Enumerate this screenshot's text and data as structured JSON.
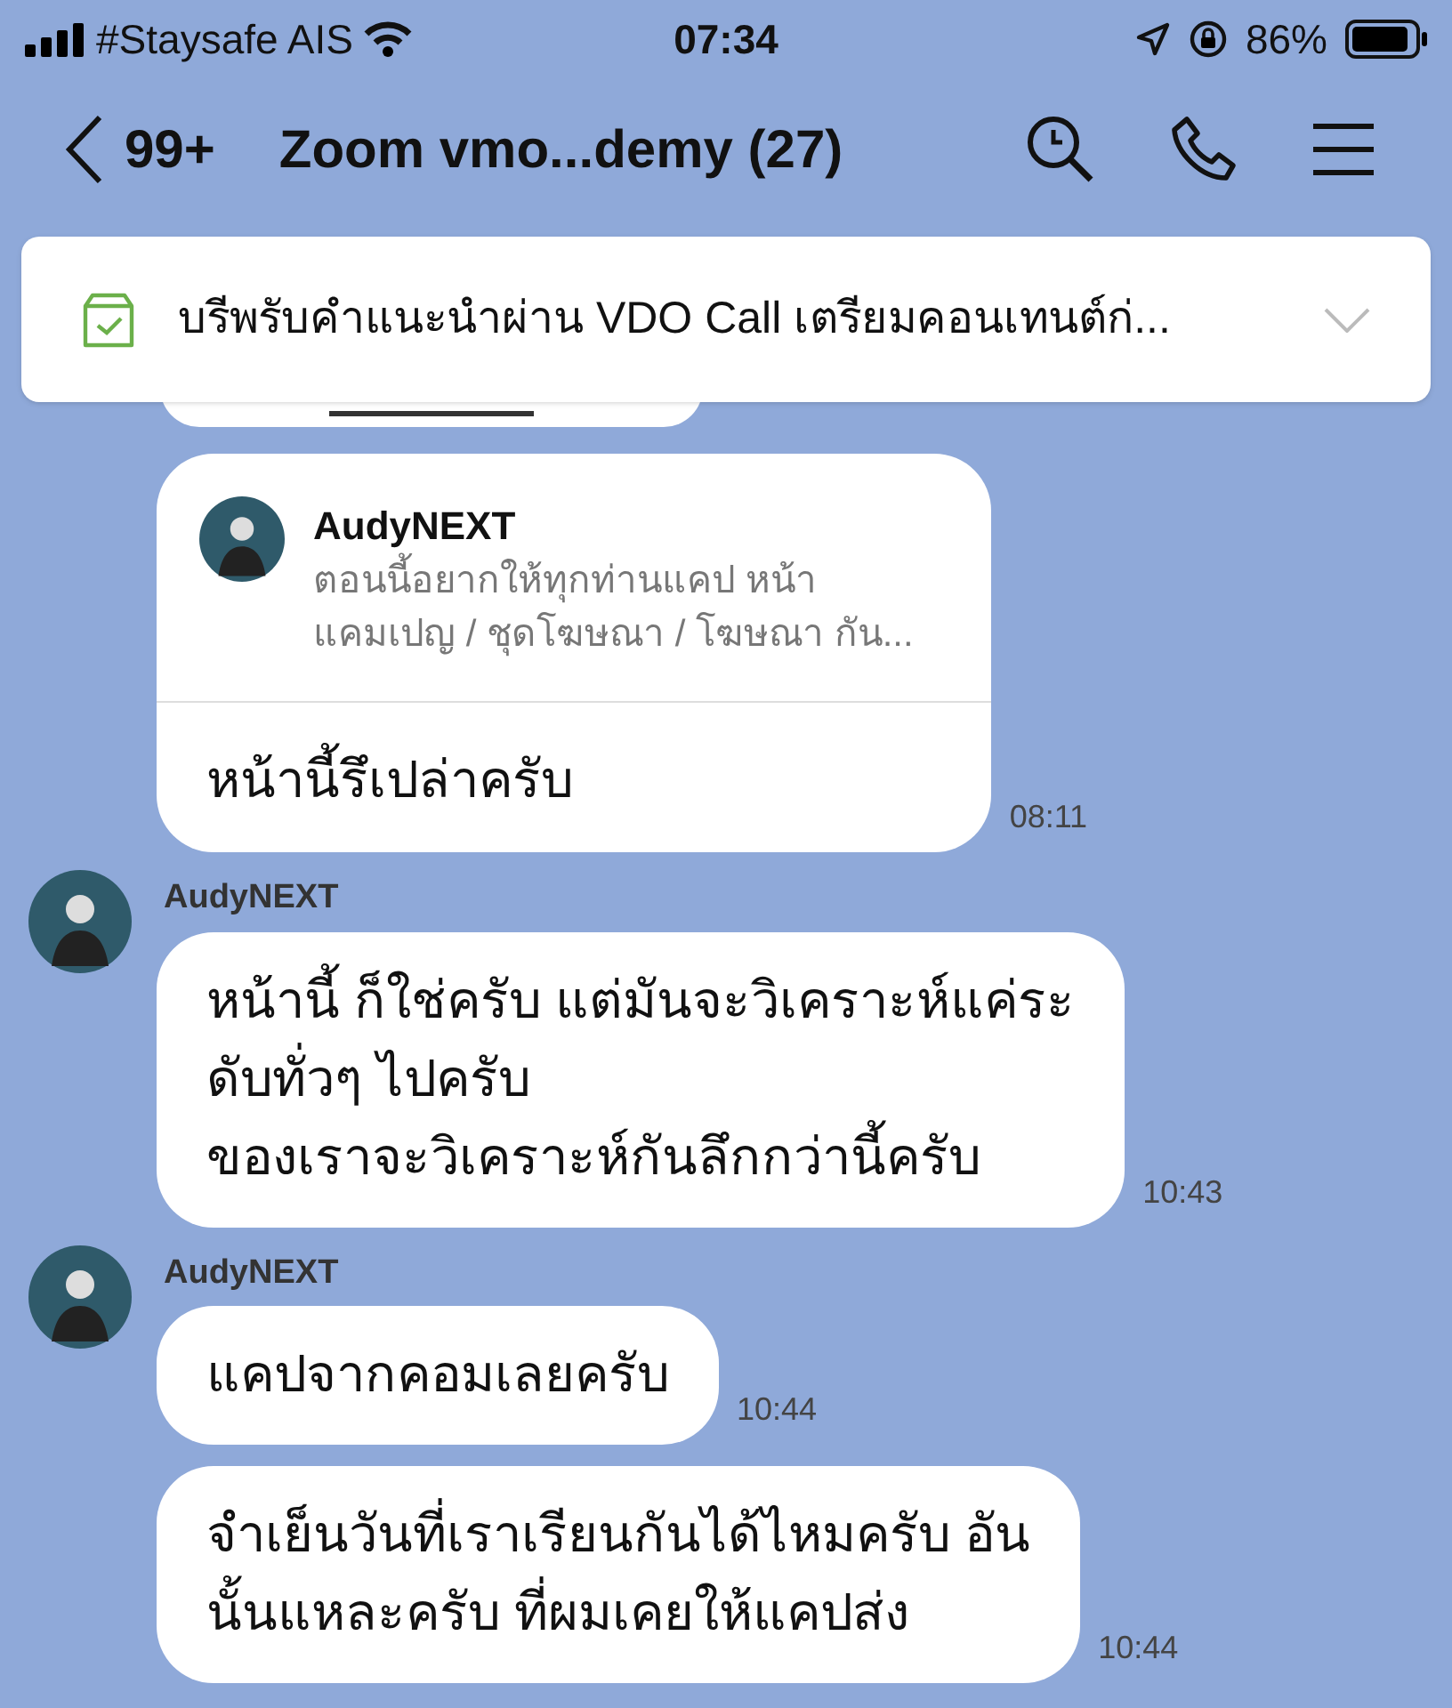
{
  "status_bar": {
    "carrier": "#Staysafe AIS",
    "time": "07:34",
    "battery": "86%"
  },
  "header": {
    "back_count": "99+",
    "title": "Zoom vmo...demy (27)"
  },
  "announcement": {
    "text": "บรีพรับคำแนะนำผ่าน VDO Call เตรียมคอนเทนต์ก่...",
    "expanded": false
  },
  "messages": [
    {
      "kind": "reply",
      "show_avatar": false,
      "quote": {
        "sender": "AudyNEXT",
        "lines": [
          "ตอนนี้อยากให้ทุกท่านแคป หน้า",
          "แคมเปญ / ชุดโฆษณา / โฆษณา กัน..."
        ]
      },
      "lines": [
        "หน้านี้รึเปล่าครับ"
      ],
      "time": "08:11"
    },
    {
      "kind": "text",
      "show_avatar": true,
      "sender": "AudyNEXT",
      "lines": [
        "หน้านี้ ก็ใช่ครับ แต่มันจะวิเคราะห์แค่ระ",
        "ดับทั่วๆ ไปครับ",
        "ของเราจะวิเคราะห์กันลึกกว่านี้ครับ"
      ],
      "time": "10:43"
    },
    {
      "kind": "text",
      "show_avatar": true,
      "sender": "AudyNEXT",
      "lines": [
        "แคปจากคอมเลยครับ"
      ],
      "time": "10:44"
    },
    {
      "kind": "text",
      "show_avatar": false,
      "lines": [
        "จำเย็นวันที่เราเรียนกันได้ไหมครับ อัน",
        "นั้นแหละครับ ที่ผมเคยให้แคปส่ง"
      ],
      "time": "10:44"
    }
  ]
}
